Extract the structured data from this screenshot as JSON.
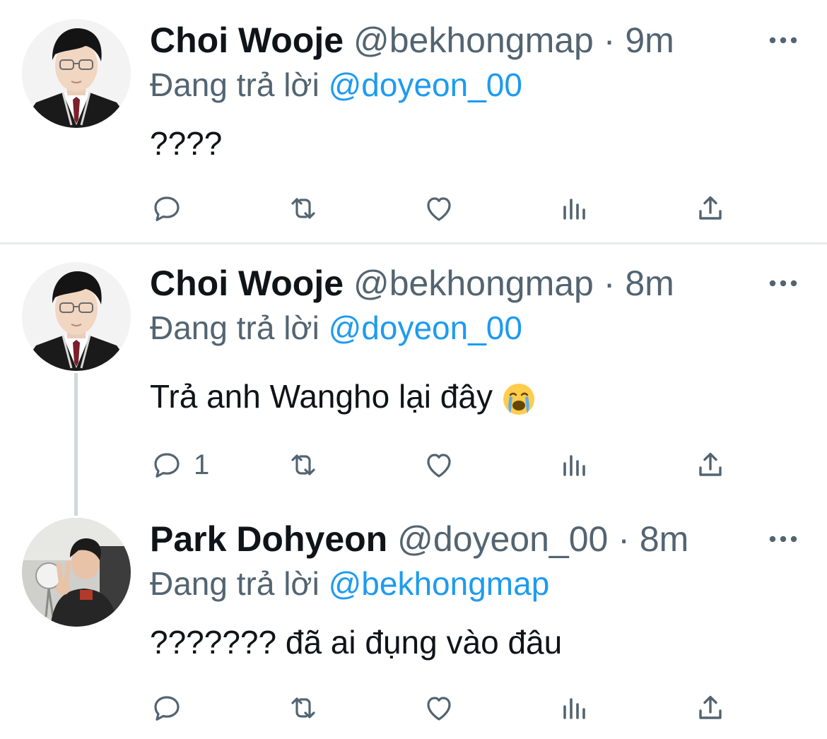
{
  "tweets": [
    {
      "name": "Choi Wooje",
      "handle": "@bekhongmap",
      "dot": "·",
      "time": "9m",
      "reply_prefix": "Đang trả lời",
      "reply_to": "@doyeon_00",
      "text": "????",
      "reply_count": "",
      "avatar": "portrait-boy-glasses-uniform"
    },
    {
      "name": "Choi Wooje",
      "handle": "@bekhongmap",
      "dot": "·",
      "time": "8m",
      "reply_prefix": "Đang trả lời",
      "reply_to": "@doyeon_00",
      "text": "Trả anh Wangho lại đây",
      "emoji": "loudly-crying-face",
      "reply_count": "1",
      "avatar": "portrait-boy-glasses-uniform"
    },
    {
      "name": "Park Dohyeon",
      "handle": "@doyeon_00",
      "dot": "·",
      "time": "8m",
      "reply_prefix": "Đang trả lời",
      "reply_to": "@bekhongmap",
      "text": "??????? đã ai đụng vào đâu",
      "reply_count": "",
      "avatar": "portrait-peace-sign"
    }
  ],
  "icons": [
    "reply-icon",
    "retweet-icon",
    "like-icon",
    "views-icon",
    "share-icon",
    "more-icon"
  ],
  "colors": {
    "text": "#0f1419",
    "secondary": "#536471",
    "link": "#1d9bf0",
    "divider": "#e6ecf0",
    "thread": "#cfd9de"
  }
}
